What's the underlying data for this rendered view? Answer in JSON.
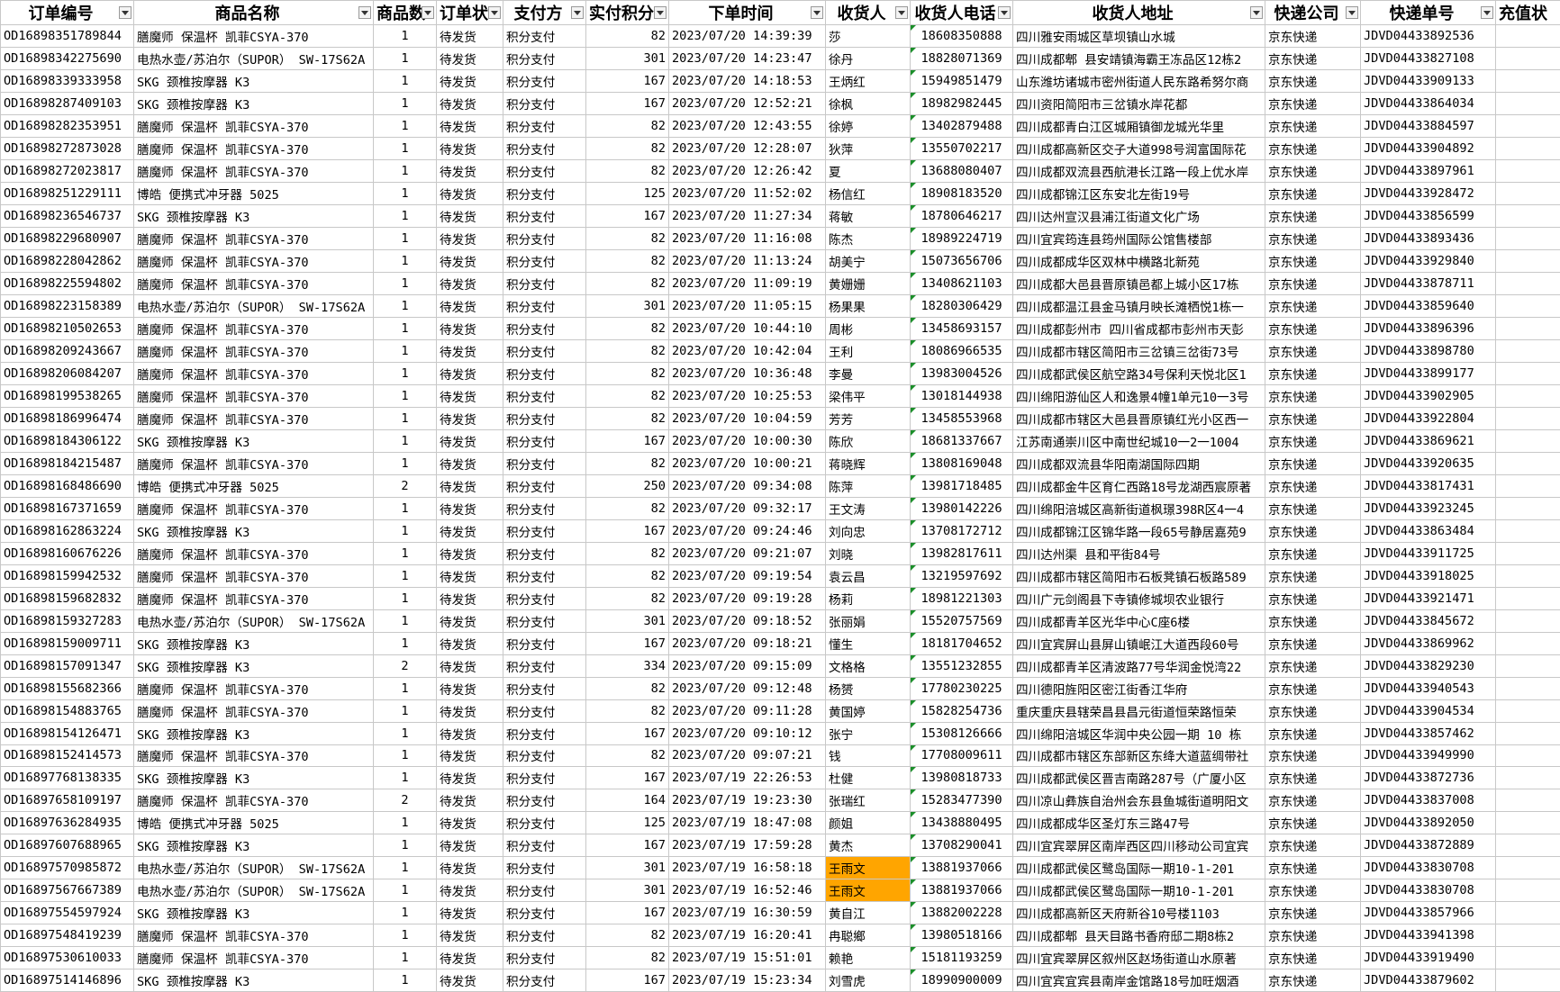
{
  "columns": [
    "订单编号",
    "商品名称",
    "商品数",
    "订单状",
    "支付方",
    "实付积分",
    "下单时间",
    "收货人",
    "收货人电话",
    "收货人地址",
    "快递公司",
    "快递单号",
    "充值状"
  ],
  "rows": [
    [
      "OD16898351789844",
      "膳魔师 保温杯 凯菲CSYA-370",
      "1",
      "待发货",
      "积分支付",
      "82",
      "2023/07/20 14:39:39",
      "莎",
      "18608350888",
      "四川雅安雨城区草坝镇山水城",
      "京东快递",
      "JDVD04433892536",
      ""
    ],
    [
      "OD16898342275690",
      "电热水壶/苏泊尔（SUPOR） SW-17S62A",
      "1",
      "待发货",
      "积分支付",
      "301",
      "2023/07/20 14:23:47",
      "徐丹",
      "18828071369",
      "四川成都郫 县安靖镇海霸王冻品区12栋2",
      "京东快递",
      "JDVD04433827108",
      ""
    ],
    [
      "OD16898339333958",
      "SKG 颈椎按摩器 K3",
      "1",
      "待发货",
      "积分支付",
      "167",
      "2023/07/20 14:18:53",
      "王炳红",
      "15949851479",
      "山东潍坊诸城市密州街道人民东路希努尔商",
      "京东快递",
      "JDVD04433909133",
      ""
    ],
    [
      "OD16898287409103",
      "SKG 颈椎按摩器 K3",
      "1",
      "待发货",
      "积分支付",
      "167",
      "2023/07/20 12:52:21",
      "徐枫",
      "18982982445",
      "四川资阳简阳市三岔镇水岸花都",
      "京东快递",
      "JDVD04433864034",
      ""
    ],
    [
      "OD16898282353951",
      "膳魔师 保温杯 凯菲CSYA-370",
      "1",
      "待发货",
      "积分支付",
      "82",
      "2023/07/20 12:43:55",
      "徐婷",
      "13402879488",
      "四川成都青白江区城厢镇御龙城光华里",
      "京东快递",
      "JDVD04433884597",
      ""
    ],
    [
      "OD16898272873028",
      "膳魔师 保温杯 凯菲CSYA-370",
      "1",
      "待发货",
      "积分支付",
      "82",
      "2023/07/20 12:28:07",
      "狄萍",
      "13550702217",
      "四川成都高新区交子大道998号润富国际花",
      "京东快递",
      "JDVD04433904892",
      ""
    ],
    [
      "OD16898272023817",
      "膳魔师 保温杯 凯菲CSYA-370",
      "1",
      "待发货",
      "积分支付",
      "82",
      "2023/07/20 12:26:42",
      "夏",
      "13688080407",
      "四川成都双流县西航港长江路一段上优水岸",
      "京东快递",
      "JDVD04433897961",
      ""
    ],
    [
      "OD16898251229111",
      "博皓 便携式冲牙器 5025",
      "1",
      "待发货",
      "积分支付",
      "125",
      "2023/07/20 11:52:02",
      "杨信红",
      "18908183520",
      "四川成都锦江区东安北左街19号",
      "京东快递",
      "JDVD04433928472",
      ""
    ],
    [
      "OD16898236546737",
      "SKG 颈椎按摩器 K3",
      "1",
      "待发货",
      "积分支付",
      "167",
      "2023/07/20 11:27:34",
      "蒋敏",
      "18780646217",
      "四川达州宣汉县浦江街道文化广场",
      "京东快递",
      "JDVD04433856599",
      ""
    ],
    [
      "OD16898229680907",
      "膳魔师 保温杯 凯菲CSYA-370",
      "1",
      "待发货",
      "积分支付",
      "82",
      "2023/07/20 11:16:08",
      "陈杰",
      "18989224719",
      "四川宜宾筠连县筠州国际公馆售楼部",
      "京东快递",
      "JDVD04433893436",
      ""
    ],
    [
      "OD16898228042862",
      "膳魔师 保温杯 凯菲CSYA-370",
      "1",
      "待发货",
      "积分支付",
      "82",
      "2023/07/20 11:13:24",
      "胡美宁",
      "15073656706",
      "四川成都成华区双林中横路北新苑",
      "京东快递",
      "JDVD04433929840",
      ""
    ],
    [
      "OD16898225594802",
      "膳魔师 保温杯 凯菲CSYA-370",
      "1",
      "待发货",
      "积分支付",
      "82",
      "2023/07/20 11:09:19",
      "黄姗姗",
      "13408621103",
      "四川成都大邑县晋原镇邑都上城小区17栋",
      "京东快递",
      "JDVD04433878711",
      ""
    ],
    [
      "OD16898223158389",
      "电热水壶/苏泊尔（SUPOR） SW-17S62A",
      "1",
      "待发货",
      "积分支付",
      "301",
      "2023/07/20 11:05:15",
      "杨果果",
      "18280306429",
      "四川成都温江县金马镇月映长滩栖悦1栋一",
      "京东快递",
      "JDVD04433859640",
      ""
    ],
    [
      "OD16898210502653",
      "膳魔师 保温杯 凯菲CSYA-370",
      "1",
      "待发货",
      "积分支付",
      "82",
      "2023/07/20 10:44:10",
      "周彬",
      "13458693157",
      "四川成都彭州市 四川省成都市彭州市天彭",
      "京东快递",
      "JDVD04433896396",
      ""
    ],
    [
      "OD16898209243667",
      "膳魔师 保温杯 凯菲CSYA-370",
      "1",
      "待发货",
      "积分支付",
      "82",
      "2023/07/20 10:42:04",
      "王利",
      "18086966535",
      "四川成都市辖区简阳市三岔镇三岔街73号",
      "京东快递",
      "JDVD04433898780",
      ""
    ],
    [
      "OD16898206084207",
      "膳魔师 保温杯 凯菲CSYA-370",
      "1",
      "待发货",
      "积分支付",
      "82",
      "2023/07/20 10:36:48",
      "李曼",
      "13983004526",
      "四川成都武侯区航空路34号保利天悦北区1",
      "京东快递",
      "JDVD04433899177",
      ""
    ],
    [
      "OD16898199538265",
      "膳魔师 保温杯 凯菲CSYA-370",
      "1",
      "待发货",
      "积分支付",
      "82",
      "2023/07/20 10:25:53",
      "梁伟平",
      "13018144938",
      "四川绵阳游仙区人和逸景4幢1单元10一3号",
      "京东快递",
      "JDVD04433902905",
      ""
    ],
    [
      "OD16898186996474",
      "膳魔师 保温杯 凯菲CSYA-370",
      "1",
      "待发货",
      "积分支付",
      "82",
      "2023/07/20 10:04:59",
      "芳芳",
      "13458553968",
      "四川成都市辖区大邑县晋原镇红光小区西一",
      "京东快递",
      "JDVD04433922804",
      ""
    ],
    [
      "OD16898184306122",
      "SKG 颈椎按摩器 K3",
      "1",
      "待发货",
      "积分支付",
      "167",
      "2023/07/20 10:00:30",
      "陈欣",
      "18681337667",
      "江苏南通崇川区中南世纪城10一2一1004",
      "京东快递",
      "JDVD04433869621",
      ""
    ],
    [
      "OD16898184215487",
      "膳魔师 保温杯 凯菲CSYA-370",
      "1",
      "待发货",
      "积分支付",
      "82",
      "2023/07/20 10:00:21",
      "蒋晓辉",
      "13808169048",
      "四川成都双流县华阳南湖国际四期",
      "京东快递",
      "JDVD04433920635",
      ""
    ],
    [
      "OD16898168486690",
      "博皓 便携式冲牙器 5025",
      "2",
      "待发货",
      "积分支付",
      "250",
      "2023/07/20 09:34:08",
      "陈萍",
      "13981718485",
      "四川成都金牛区育仁西路18号龙湖西宸原著",
      "京东快递",
      "JDVD04433817431",
      ""
    ],
    [
      "OD16898167371659",
      "膳魔师 保温杯 凯菲CSYA-370",
      "1",
      "待发货",
      "积分支付",
      "82",
      "2023/07/20 09:32:17",
      "王文涛",
      "13980142226",
      "四川绵阳涪城区高新街道枫璟398R区4一4",
      "京东快递",
      "JDVD04433923245",
      ""
    ],
    [
      "OD16898162863224",
      "SKG 颈椎按摩器 K3",
      "1",
      "待发货",
      "积分支付",
      "167",
      "2023/07/20 09:24:46",
      "刘向忠",
      "13708172712",
      "四川成都锦江区锦华路一段65号静居嘉苑9",
      "京东快递",
      "JDVD04433863484",
      ""
    ],
    [
      "OD16898160676226",
      "膳魔师 保温杯 凯菲CSYA-370",
      "1",
      "待发货",
      "积分支付",
      "82",
      "2023/07/20 09:21:07",
      "刘晓",
      "13982817611",
      "四川达州渠 县和平街84号",
      "京东快递",
      "JDVD04433911725",
      ""
    ],
    [
      "OD16898159942532",
      "膳魔师 保温杯 凯菲CSYA-370",
      "1",
      "待发货",
      "积分支付",
      "82",
      "2023/07/20 09:19:54",
      "袁云昌",
      "13219597692",
      "四川成都市辖区简阳市石板凳镇石板路589",
      "京东快递",
      "JDVD04433918025",
      ""
    ],
    [
      "OD16898159682832",
      "膳魔师 保温杯 凯菲CSYA-370",
      "1",
      "待发货",
      "积分支付",
      "82",
      "2023/07/20 09:19:28",
      "杨莉",
      "18981221303",
      "四川广元剑阁县下寺镇修城坝农业银行",
      "京东快递",
      "JDVD04433921471",
      ""
    ],
    [
      "OD16898159327283",
      "电热水壶/苏泊尔（SUPOR） SW-17S62A",
      "1",
      "待发货",
      "积分支付",
      "301",
      "2023/07/20 09:18:52",
      "张丽娟",
      "15520757569",
      "四川成都青羊区光华中心C座6楼",
      "京东快递",
      "JDVD04433845672",
      ""
    ],
    [
      "OD16898159009711",
      "SKG 颈椎按摩器 K3",
      "1",
      "待发货",
      "积分支付",
      "167",
      "2023/07/20 09:18:21",
      "懂生",
      "18181704652",
      "四川宜宾屏山县屏山镇岷江大道西段60号",
      "京东快递",
      "JDVD04433869962",
      ""
    ],
    [
      "OD16898157091347",
      "SKG 颈椎按摩器 K3",
      "2",
      "待发货",
      "积分支付",
      "334",
      "2023/07/20 09:15:09",
      "文格格",
      "13551232855",
      "四川成都青羊区清波路77号华润金悦湾22",
      "京东快递",
      "JDVD04433829230",
      ""
    ],
    [
      "OD16898155682366",
      "膳魔师 保温杯 凯菲CSYA-370",
      "1",
      "待发货",
      "积分支付",
      "82",
      "2023/07/20 09:12:48",
      "杨赟",
      "17780230225",
      "四川德阳旌阳区密江街香江华府",
      "京东快递",
      "JDVD04433940543",
      ""
    ],
    [
      "OD16898154883765",
      "膳魔师 保温杯 凯菲CSYA-370",
      "1",
      "待发货",
      "积分支付",
      "82",
      "2023/07/20 09:11:28",
      "黄国婷",
      "15828254736",
      "重庆重庆县辖荣昌县昌元街道恒荣路恒荣",
      "京东快递",
      "JDVD04433904534",
      ""
    ],
    [
      "OD16898154126471",
      "SKG 颈椎按摩器 K3",
      "1",
      "待发货",
      "积分支付",
      "167",
      "2023/07/20 09:10:12",
      "张宁",
      "15308126666",
      "四川绵阳涪城区华润中央公园一期 10 栋",
      "京东快递",
      "JDVD04433857462",
      ""
    ],
    [
      "OD16898152414573",
      "膳魔师 保温杯 凯菲CSYA-370",
      "1",
      "待发货",
      "积分支付",
      "82",
      "2023/07/20 09:07:21",
      "钱",
      "17708009611",
      "四川成都市辖区东部新区东绛大道蓝绸带社",
      "京东快递",
      "JDVD04433949990",
      ""
    ],
    [
      "OD16897768138335",
      "SKG 颈椎按摩器 K3",
      "1",
      "待发货",
      "积分支付",
      "167",
      "2023/07/19 22:26:53",
      "杜健",
      "13980818733",
      "四川成都武侯区晋吉南路287号（广厦小区",
      "京东快递",
      "JDVD04433872736",
      ""
    ],
    [
      "OD16897658109197",
      "膳魔师 保温杯 凯菲CSYA-370",
      "2",
      "待发货",
      "积分支付",
      "164",
      "2023/07/19 19:23:30",
      "张瑞红",
      "15283477390",
      "四川凉山彝族自治州会东县鱼城街道明阳文",
      "京东快递",
      "JDVD04433837008",
      ""
    ],
    [
      "OD16897636284935",
      "博皓 便携式冲牙器 5025",
      "1",
      "待发货",
      "积分支付",
      "125",
      "2023/07/19 18:47:08",
      "颜姐",
      "13438880495",
      "四川成都成华区圣灯东三路47号",
      "京东快递",
      "JDVD04433892050",
      ""
    ],
    [
      "OD16897607688965",
      "SKG 颈椎按摩器 K3",
      "1",
      "待发货",
      "积分支付",
      "167",
      "2023/07/19 17:59:28",
      "黄杰",
      "13708290041",
      "四川宜宾翠屏区南岸西区四川移动公司宜宾",
      "京东快递",
      "JDVD04433872889",
      ""
    ],
    [
      "OD16897570985872",
      "电热水壶/苏泊尔（SUPOR） SW-17S62A",
      "1",
      "待发货",
      "积分支付",
      "301",
      "2023/07/19 16:58:18",
      "王雨文",
      "13881937066",
      "四川成都武侯区鹭岛国际一期10-1-201",
      "京东快递",
      "JDVD04433830708",
      ""
    ],
    [
      "OD16897567667389",
      "电热水壶/苏泊尔（SUPOR） SW-17S62A",
      "1",
      "待发货",
      "积分支付",
      "301",
      "2023/07/19 16:52:46",
      "王雨文",
      "13881937066",
      "四川成都武侯区鹭岛国际一期10-1-201",
      "京东快递",
      "JDVD04433830708",
      ""
    ],
    [
      "OD16897554597924",
      "SKG 颈椎按摩器 K3",
      "1",
      "待发货",
      "积分支付",
      "167",
      "2023/07/19 16:30:59",
      "黄自江",
      "13882002228",
      "四川成都高新区天府新谷10号楼1103",
      "京东快递",
      "JDVD04433857966",
      ""
    ],
    [
      "OD16897548419239",
      "膳魔师 保温杯 凯菲CSYA-370",
      "1",
      "待发货",
      "积分支付",
      "82",
      "2023/07/19 16:20:41",
      "冉聪鄉",
      "13980518166",
      "四川成都郫 县天目路书香府邸二期8栋2",
      "京东快递",
      "JDVD04433941398",
      ""
    ],
    [
      "OD16897530610033",
      "膳魔师 保温杯 凯菲CSYA-370",
      "1",
      "待发货",
      "积分支付",
      "82",
      "2023/07/19 15:51:01",
      "赖艳",
      "15181193259",
      "四川宜宾翠屏区叙州区赵场街道山水原著",
      "京东快递",
      "JDVD04433919490",
      ""
    ],
    [
      "OD16897514146896",
      "SKG 颈椎按摩器 K3",
      "1",
      "待发货",
      "积分支付",
      "167",
      "2023/07/19 15:23:34",
      "刘雪虎",
      "18990900009",
      "四川宜宾宜宾县南岸金馆路18号加旺烟酒",
      "京东快递",
      "JDVD04433879602",
      ""
    ]
  ],
  "highlight_color": "#ffa500",
  "highlight_rows": [
    37,
    38
  ],
  "flag_color": "#1b8f2a"
}
